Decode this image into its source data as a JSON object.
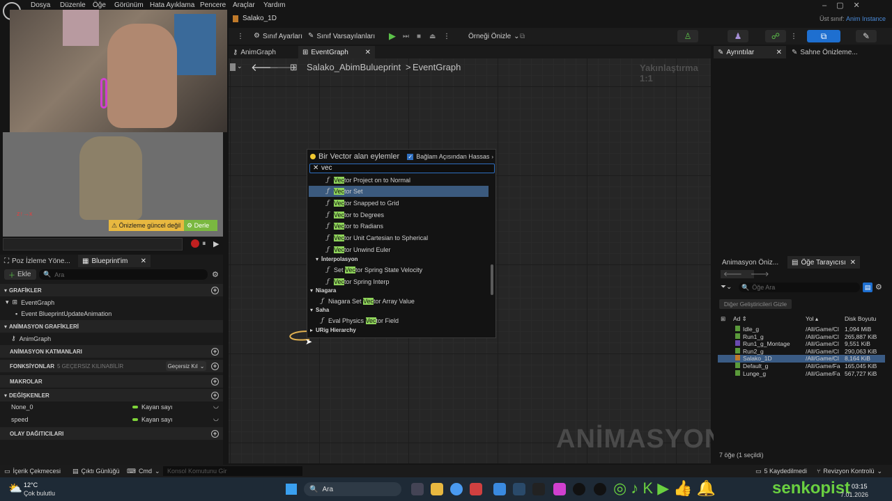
{
  "menu": [
    "Dosya",
    "Düzenle",
    "Öğe",
    "Görünüm",
    "Hata Ayıklama",
    "Pencere",
    "Araçlar",
    "Yardım"
  ],
  "asset_title": "Salako_1D",
  "parent_class_label": "Üst sınıf:",
  "parent_class_value": "Anim Instance",
  "toolbar": {
    "class_settings": "Sınıf Ayarları",
    "class_defaults": "Sınıf Varsayılanları",
    "preview_instance": "Örneği Önizle"
  },
  "graph_tabs": {
    "anim_graph": "AnimGraph",
    "event_graph": "EventGraph"
  },
  "breadcrumb": {
    "blueprint": "Salako_AbimBulueprint",
    "graph": "EventGraph"
  },
  "zoom_label": "Yakınlaştırma 1:1",
  "watermark": "ANİMASYON",
  "viewport": {
    "preview_outdated": "Önizleme güncel değil",
    "compile": "Derle"
  },
  "popup": {
    "title": "Bir Vector alan eylemler",
    "context_sensitive": "Bağlam Açısından Hassas",
    "search_value": "vec",
    "items": [
      {
        "pre": "",
        "hl": "Vec",
        "post": "tor Project on to Normal"
      },
      {
        "pre": "",
        "hl": "Vec",
        "post": "tor Set"
      },
      {
        "pre": "",
        "hl": "Vec",
        "post": "tor Snapped to Grid"
      },
      {
        "pre": "",
        "hl": "Vec",
        "post": "tor to Degrees"
      },
      {
        "pre": "",
        "hl": "Vec",
        "post": "tor to Radians"
      },
      {
        "pre": "",
        "hl": "Vec",
        "post": "tor Unit Cartesian to Spherical"
      },
      {
        "pre": "",
        "hl": "Vec",
        "post": "tor Unwind Euler"
      },
      {
        "pre": "Set ",
        "hl": "Vec",
        "post": "tor Spring State Velocity"
      },
      {
        "pre": "",
        "hl": "Vec",
        "post": "tor Spring Interp"
      },
      {
        "pre": "Niagara Set ",
        "hl": "Vec",
        "post": "tor Array Value"
      },
      {
        "pre": "Eval Physics ",
        "hl": "Vec",
        "post": "tor Field"
      }
    ],
    "categories": {
      "interpolation": "İnterpolasyon",
      "niagara": "Niagara",
      "field": "Saha",
      "urig": "URig Hierarchy"
    }
  },
  "left_tabs": {
    "pose_watch": "Poz İzleme Yöne...",
    "my_blueprint": "Blueprint'im"
  },
  "my_blueprint": {
    "add": "Ekle",
    "search_placeholder": "Ara",
    "graphs_header": "GRAFİKLER",
    "event_graph": "EventGraph",
    "event_update": "Event BlueprintUpdateAnimation",
    "anim_graphs_header": "ANİMASYON GRAFİKLERİ",
    "anim_graph": "AnimGraph",
    "anim_layers_header": "ANİMASYON KATMANLARI",
    "functions_header": "FONKSİYONLAR",
    "functions_note": "5 GEÇERSİZ KILINABİLİR",
    "override": "Geçersiz Kıl",
    "macros_header": "MAKROLAR",
    "variables_header": "DEĞİŞKENLER",
    "variables": [
      {
        "name": "None_0",
        "type": "Kayan sayı"
      },
      {
        "name": "speed",
        "type": "Kayan sayı"
      }
    ],
    "dispatchers_header": "OLAY DAĞITICILARI"
  },
  "right_tabs": {
    "details": "Ayrıntılar",
    "scene_preview": "Sahne Önizleme..."
  },
  "asset_browser": {
    "tab_anim_preview": "Animasyon Öniz...",
    "tab_asset_browser": "Öğe Tarayıcısı",
    "search_placeholder": "Öğe Ara",
    "hide_other_devs": "Diğer Geliştiricileri Gizle",
    "columns": {
      "name": "Ad",
      "path": "Yol",
      "size": "Disk Boyutu"
    },
    "rows": [
      {
        "name": "Idle_g",
        "path": "/All/Game/Cl",
        "size": "1,094 MiB",
        "color": "#5a9a3a"
      },
      {
        "name": "Run1_g",
        "path": "/All/Game/Cl",
        "size": "265,887 KiB",
        "color": "#5a9a3a"
      },
      {
        "name": "Run1_g_Montage",
        "path": "/All/Game/Cl",
        "size": "9,551 KiB",
        "color": "#6a4ab0"
      },
      {
        "name": "Run2_g",
        "path": "/All/Game/Cl",
        "size": "290,063 KiB",
        "color": "#5a9a3a"
      },
      {
        "name": "Salako_1D",
        "path": "/All/Game/Cl",
        "size": "8,164 KiB",
        "color": "#c07a2a"
      },
      {
        "name": "Default_g",
        "path": "/All/Game/Fa",
        "size": "165,045 KiB",
        "color": "#5a9a3a"
      },
      {
        "name": "Lunge_g",
        "path": "/All/Game/Fa",
        "size": "567,727 KiB",
        "color": "#5a9a3a"
      }
    ],
    "status": "7 öğe (1 seçildi)"
  },
  "statusbar": {
    "content_drawer": "İçerik Çekmecesi",
    "output_log": "Çıktı Günlüğü",
    "cmd": "Cmd",
    "console_placeholder": "Konsol Komutunu Gir",
    "saved": "5 Kaydedilmedi",
    "revision": "Revizyon Kontrolü"
  },
  "taskbar": {
    "temp": "12°C",
    "weather": "Çok bulutlu",
    "search": "Ara",
    "time": "03:15",
    "date": "7.01.2026",
    "brand": "senkopist"
  },
  "colors": {
    "accent": "#2f6fc0",
    "highlight": "#8fd45a",
    "selected": "#3b5a7e"
  }
}
